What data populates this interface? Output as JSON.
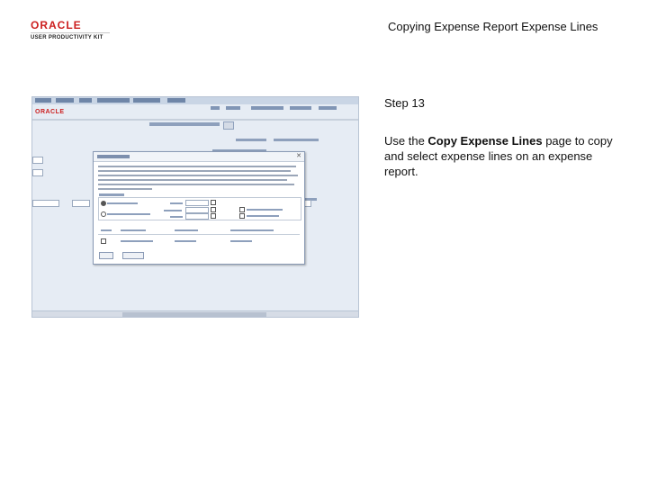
{
  "header": {
    "logo_brand": "ORACLE",
    "logo_subtitle": "USER PRODUCTIVITY KIT",
    "document_title": "Copying Expense Report Expense Lines"
  },
  "step": {
    "label": "Step 13",
    "text_before": "Use the ",
    "text_bold": "Copy Expense Lines",
    "text_after": " page to copy and select expense lines on an expense report."
  },
  "colors": {
    "brand": "#cc1f1f",
    "screenshot_bg": "#e6ecf4",
    "dialog_border": "#8a9ab5"
  }
}
